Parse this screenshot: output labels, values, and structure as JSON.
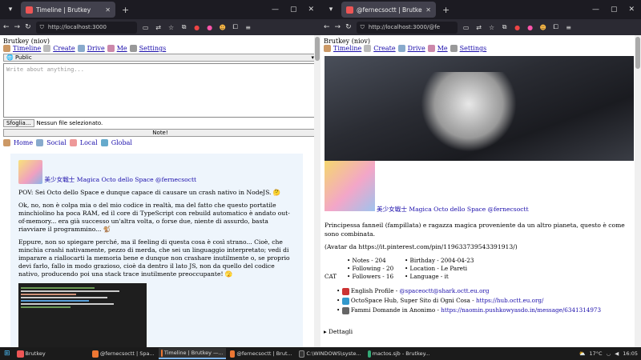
{
  "left": {
    "tab_title": "Timeline | Brutkey",
    "url": "http://localhost:3000",
    "site_title": "Brutkey (niov)",
    "menu": [
      "Timeline",
      "Create",
      "Drive",
      "Me",
      "Settings"
    ],
    "visibility": "Public",
    "compose_placeholder": "Write about anything...",
    "file_button": "Sfoglia...",
    "file_status": "Nessun file selezionato.",
    "note_button": "Note!",
    "timeline_nav": [
      "Home",
      "Social",
      "Local",
      "Global"
    ],
    "post": {
      "author": "美少女戦士 Magica Octo dello Space @fernecsoctt",
      "paragraphs": [
        "POV: Sei Octo dello Space e dunque capace di causare un crash nativo in NodeJS. 🤔",
        "Ok, no, non è colpa mia o del mio codice in realtà, ma del fatto che questo portatile minchiolino ha poca RAM, ed il core di TypeScript con rebuild automatico è andato out-of-memory... era già successo un'altra volta, o forse due, niente di assurdo, basta riavviare il programmino... 🐒",
        "Eppure, non so spiegare perché, ma il feeling di questa cosa è così strano... Cioè, che minchia crashi nativamente, pezzo di merda, che sei un linguaggio interpretato; vedi di imparare a riallocarti la memoria bene e dunque non crashare inutilmente o, se proprio devi farlo, fallo in modo grazioso, cioè da dentro il lato JS, non da quello del codice nativo, producendo poi una stack trace inutilmente preoccupante! 🫣"
      ]
    }
  },
  "right": {
    "tab_title": "@fernecsoctt | Brutkey",
    "url": "http://localhost:3000/@fe",
    "site_title": "Brutkey (niov)",
    "menu": [
      "Timeline",
      "Create",
      "Drive",
      "Me",
      "Settings"
    ],
    "display_name": "美少女戦士 Magica Octo dello Space @fernecsoctt",
    "bio": "Principessa fanneil (fampillata) e ragazza magica proveniente da un altro pianeta, questo è come sono combinata.",
    "avatar_credit": "(Avatar da https://it.pinterest.com/pin/119633739543391913/)",
    "cat_label": "CAT",
    "stats_col1": [
      "Notes - 204",
      "Following - 20",
      "Followers - 16"
    ],
    "stats_col2": [
      "Birthday - 2004-04-23",
      "Location - Le Pareti",
      "Language - it"
    ],
    "links": [
      {
        "label": "English Profile - ",
        "link": "@spaceoctt@shark.octt.eu.org"
      },
      {
        "label": "OctoSpace Hub, Super Sito di Ogni Cosa - ",
        "link": "https://hub.octt.eu.org/"
      },
      {
        "label": "Fammi Domande in Anonimo - ",
        "link": "https://naomin.pushkowyasdo.in/message/6341314973"
      }
    ],
    "details_label": "▸ Dettagli"
  },
  "taskbar": {
    "items": [
      "Brutkey",
      "@fernecsoctt | Spa...",
      "Timeline | Brutkey —...",
      "@fernecsoctt | Brut...",
      "C:\\WINDOWS\\syste...",
      "mactos.sjb - Brutkey..."
    ],
    "temp": "17°C",
    "time": "16:05"
  },
  "colors": {
    "link": "#1a0dab",
    "post_bg": "#eef5fc",
    "chrome": "#2b2a33"
  }
}
